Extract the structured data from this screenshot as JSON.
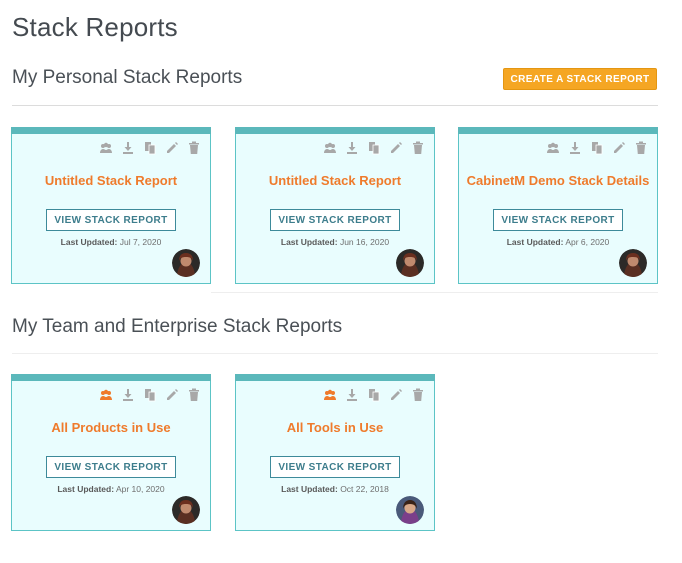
{
  "page": {
    "title": "Stack Reports"
  },
  "personal": {
    "heading": "My Personal Stack Reports",
    "create_label": "CREATE A STACK REPORT",
    "cards": [
      {
        "title": "Untitled Stack Report",
        "button": "VIEW STACK REPORT",
        "updated_label": "Last Updated:",
        "updated_date": "Jul 7, 2020"
      },
      {
        "title": "Untitled Stack Report",
        "button": "VIEW STACK REPORT",
        "updated_label": "Last Updated:",
        "updated_date": "Jun 16, 2020"
      },
      {
        "title": "CabinetM Demo Stack Details",
        "button": "VIEW STACK REPORT",
        "updated_label": "Last Updated:",
        "updated_date": "Apr 6, 2020"
      }
    ]
  },
  "team": {
    "heading": "My Team and Enterprise Stack Reports",
    "cards": [
      {
        "title": "All Products in Use",
        "button": "VIEW STACK REPORT",
        "updated_label": "Last Updated:",
        "updated_date": "Apr 10, 2020"
      },
      {
        "title": "All Tools in Use",
        "button": "VIEW STACK REPORT",
        "updated_label": "Last Updated:",
        "updated_date": "Oct 22, 2018"
      }
    ]
  },
  "colors": {
    "accent": "#f5a623",
    "card_bg": "#e9fdfe",
    "card_top": "#5bb8bb",
    "title_orange": "#ef7b2c",
    "icon_gray": "#a8a8a8",
    "share_active": "#ef7b2c"
  },
  "icons": [
    "team-share-icon",
    "download-icon",
    "copy-icon",
    "edit-icon",
    "delete-icon"
  ]
}
